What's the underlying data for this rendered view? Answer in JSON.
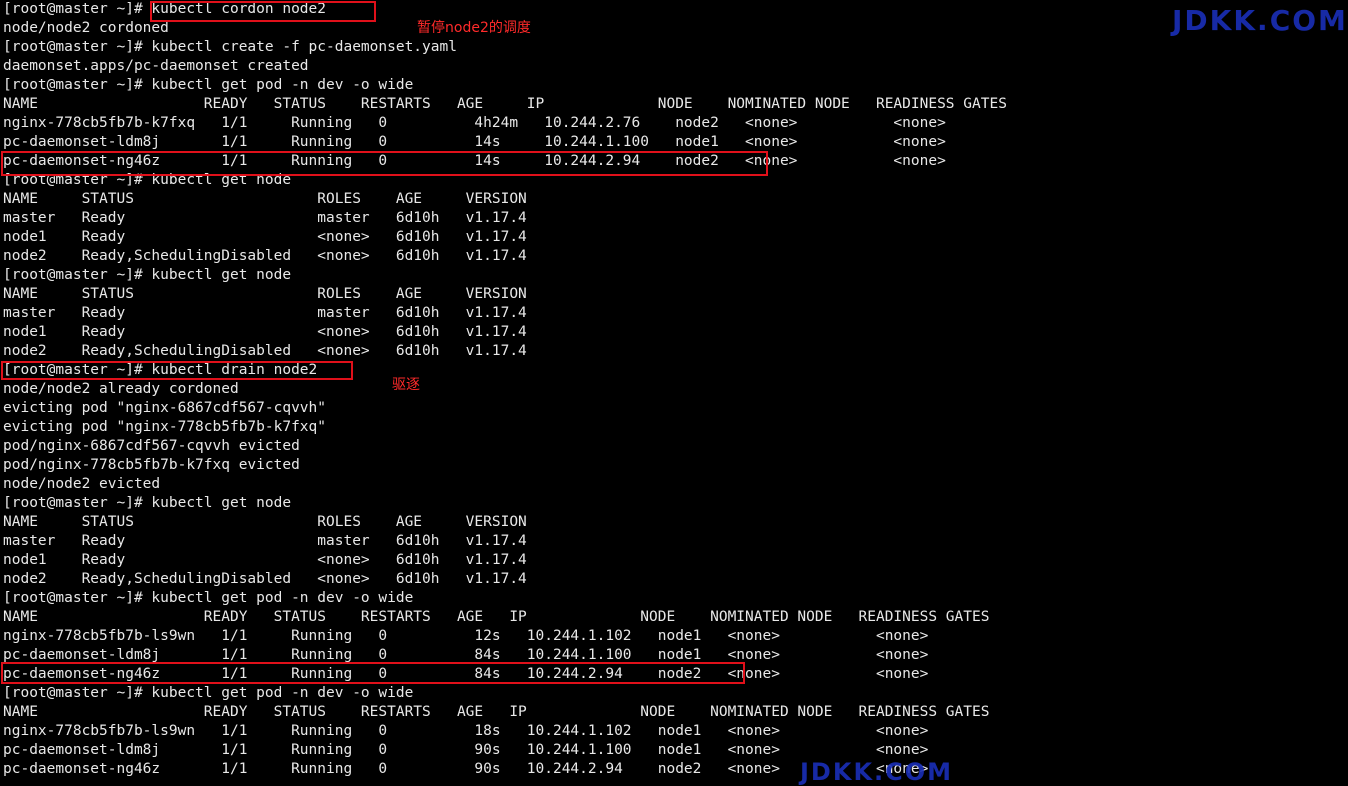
{
  "terminal": {
    "lines": [
      "[root@master ~]# kubectl cordon node2",
      "node/node2 cordoned",
      "[root@master ~]# kubectl create -f pc-daemonset.yaml",
      "daemonset.apps/pc-daemonset created",
      "[root@master ~]# kubectl get pod -n dev -o wide",
      "NAME                   READY   STATUS    RESTARTS   AGE     IP             NODE    NOMINATED NODE   READINESS GATES",
      "nginx-778cb5fb7b-k7fxq   1/1     Running   0          4h24m   10.244.2.76    node2   <none>           <none>",
      "pc-daemonset-ldm8j       1/1     Running   0          14s     10.244.1.100   node1   <none>           <none>",
      "pc-daemonset-ng46z       1/1     Running   0          14s     10.244.2.94    node2   <none>           <none>",
      "[root@master ~]# kubectl get node",
      "NAME     STATUS                     ROLES    AGE     VERSION",
      "master   Ready                      master   6d10h   v1.17.4",
      "node1    Ready                      <none>   6d10h   v1.17.4",
      "node2    Ready,SchedulingDisabled   <none>   6d10h   v1.17.4",
      "[root@master ~]# kubectl get node",
      "NAME     STATUS                     ROLES    AGE     VERSION",
      "master   Ready                      master   6d10h   v1.17.4",
      "node1    Ready                      <none>   6d10h   v1.17.4",
      "node2    Ready,SchedulingDisabled   <none>   6d10h   v1.17.4",
      "[root@master ~]# kubectl drain node2",
      "node/node2 already cordoned",
      "evicting pod \"nginx-6867cdf567-cqvvh\"",
      "evicting pod \"nginx-778cb5fb7b-k7fxq\"",
      "pod/nginx-6867cdf567-cqvvh evicted",
      "pod/nginx-778cb5fb7b-k7fxq evicted",
      "node/node2 evicted",
      "[root@master ~]# kubectl get node",
      "NAME     STATUS                     ROLES    AGE     VERSION",
      "master   Ready                      master   6d10h   v1.17.4",
      "node1    Ready                      <none>   6d10h   v1.17.4",
      "node2    Ready,SchedulingDisabled   <none>   6d10h   v1.17.4",
      "[root@master ~]# kubectl get pod -n dev -o wide",
      "NAME                   READY   STATUS    RESTARTS   AGE   IP             NODE    NOMINATED NODE   READINESS GATES",
      "nginx-778cb5fb7b-ls9wn   1/1     Running   0          12s   10.244.1.102   node1   <none>           <none>",
      "pc-daemonset-ldm8j       1/1     Running   0          84s   10.244.1.100   node1   <none>           <none>",
      "pc-daemonset-ng46z       1/1     Running   0          84s   10.244.2.94    node2   <none>           <none>",
      "[root@master ~]# kubectl get pod -n dev -o wide",
      "NAME                   READY   STATUS    RESTARTS   AGE   IP             NODE    NOMINATED NODE   READINESS GATES",
      "nginx-778cb5fb7b-ls9wn   1/1     Running   0          18s   10.244.1.102   node1   <none>           <none>",
      "pc-daemonset-ldm8j       1/1     Running   0          90s   10.244.1.100   node1   <none>           <none>",
      "pc-daemonset-ng46z       1/1     Running   0          90s   10.244.2.94    node2   <none>           <none>"
    ]
  },
  "annotations": {
    "pause_scheduling": "暂停node2的调度",
    "evict": "驱逐"
  },
  "watermark": {
    "top_right": "JDKK.COM",
    "bottom": "JDKK.COM"
  },
  "colors": {
    "background": "#000000",
    "text": "#e8e8e8",
    "highlight": "#e0101a",
    "annotation": "#ff2a2a",
    "watermark": "#1a2fb8"
  }
}
